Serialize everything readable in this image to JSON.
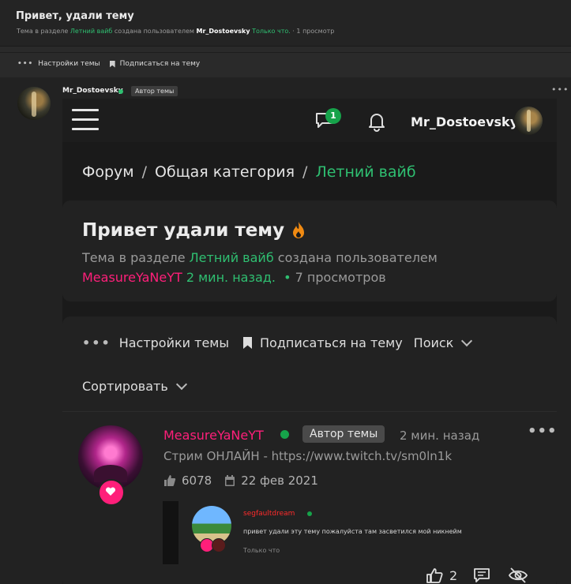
{
  "topic": {
    "title": "Привет, удали тему",
    "meta_prefix": "Тема в разделе",
    "section": "Летний вайб",
    "meta_created_by": "создана пользователем",
    "author": "Mr_Dostoevsky",
    "time": "Только что.",
    "views": "· 1 просмотр"
  },
  "toolbar": {
    "settings_label": "Настройки темы",
    "subscribe_label": "Подписаться на тему"
  },
  "post": {
    "author": "Mr_Dostoevsky",
    "badge": "Автор темы"
  },
  "embedded": {
    "chat_badge_count": "1",
    "username": "Mr_Dostoevsky",
    "breadcrumb": [
      "Форум",
      "Общая категория",
      "Летний вайб"
    ],
    "title": "Привет удали тему",
    "meta_prefix": "Тема в разделе",
    "section": "Летний вайб",
    "meta_created_by": "создана пользователем",
    "author": "MeasureYaNeYT",
    "time": "2 мин. назад.",
    "views": "7 просмотров",
    "toolbar_settings": "Настройки темы",
    "toolbar_subscribe": "Подписаться на тему",
    "toolbar_search": "Поиск",
    "sort_label": "Сортировать",
    "post_author": "MeasureYaNeYT",
    "post_badge": "Автор темы",
    "post_time": "2 мин. назад",
    "signature": "Стрим ОНЛАЙН - https://www.twitch.tv/sm0ln1k",
    "likes": "6078",
    "reg_date": "22 фев 2021",
    "inner_author": "segfaultdream",
    "inner_text": "привет удали эту тему пожалуйста там засветился мой никнейм",
    "inner_time": "Только что",
    "like_count": "2"
  },
  "colors": {
    "accent_green": "#2fbf71",
    "accent_pink": "#ff1f7a"
  }
}
